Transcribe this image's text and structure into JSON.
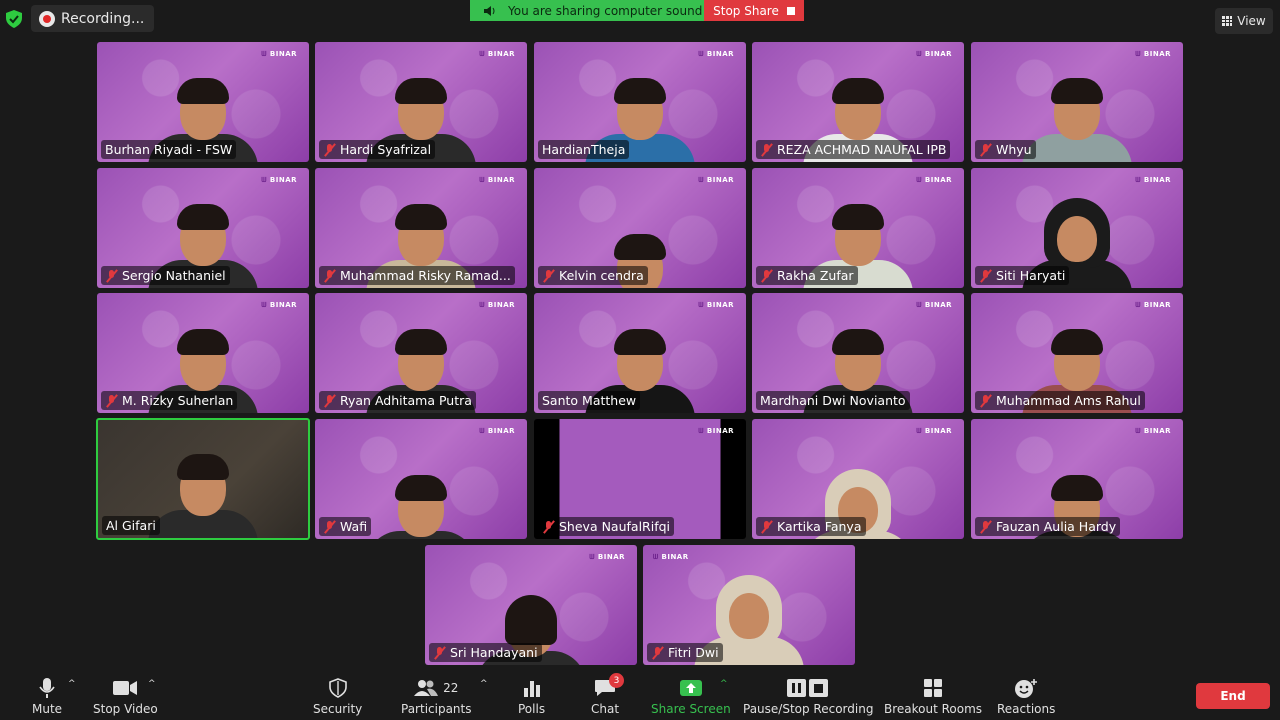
{
  "top": {
    "recording_label": "Recording...",
    "sharing_sound": "You are sharing computer sound",
    "stop_share": "Stop Share",
    "view_label": "View",
    "brand_text": "BINAR"
  },
  "participants": [
    {
      "name": "Burhan Riyadi - FSW",
      "muted": false
    },
    {
      "name": "Hardi Syafrizal",
      "muted": true
    },
    {
      "name": "HardianTheja",
      "muted": false
    },
    {
      "name": "REZA ACHMAD NAUFAL IPB",
      "muted": true
    },
    {
      "name": "Whyu",
      "muted": true
    },
    {
      "name": "Sergio Nathaniel",
      "muted": true
    },
    {
      "name": "Muhammad Risky Ramad...",
      "muted": true
    },
    {
      "name": "Kelvin cendra",
      "muted": true
    },
    {
      "name": "Rakha  Zufar",
      "muted": true
    },
    {
      "name": "Siti Haryati",
      "muted": true
    },
    {
      "name": "M. Rizky Suherlan",
      "muted": true
    },
    {
      "name": "Ryan Adhitama Putra",
      "muted": true
    },
    {
      "name": "Santo Matthew",
      "muted": false
    },
    {
      "name": "Mardhani Dwi Novianto",
      "muted": false
    },
    {
      "name": "Muhammad Ams Rahul",
      "muted": true
    },
    {
      "name": "Al Gifari",
      "muted": false
    },
    {
      "name": "Wafi",
      "muted": true
    },
    {
      "name": "Sheva NaufalRifqi",
      "muted": true
    },
    {
      "name": "Kartika Fanya",
      "muted": true
    },
    {
      "name": "Fauzan Aulia Hardy",
      "muted": true
    },
    {
      "name": "Sri Handayani",
      "muted": true
    },
    {
      "name": "Fitri Dwi",
      "muted": true
    }
  ],
  "toolbar": {
    "mute": "Mute",
    "stop_video": "Stop Video",
    "security": "Security",
    "participants": "Participants",
    "participants_count": "22",
    "polls": "Polls",
    "chat": "Chat",
    "chat_badge": "3",
    "share_screen": "Share Screen",
    "pause_recording": "Pause/Stop Recording",
    "breakout": "Breakout Rooms",
    "reactions": "Reactions",
    "end": "End"
  },
  "colors": {
    "share_green": "#37c04f",
    "stop_red": "#e0393e",
    "tile_purple": "#a45bbd",
    "active_speaker": "#2ecc40"
  }
}
